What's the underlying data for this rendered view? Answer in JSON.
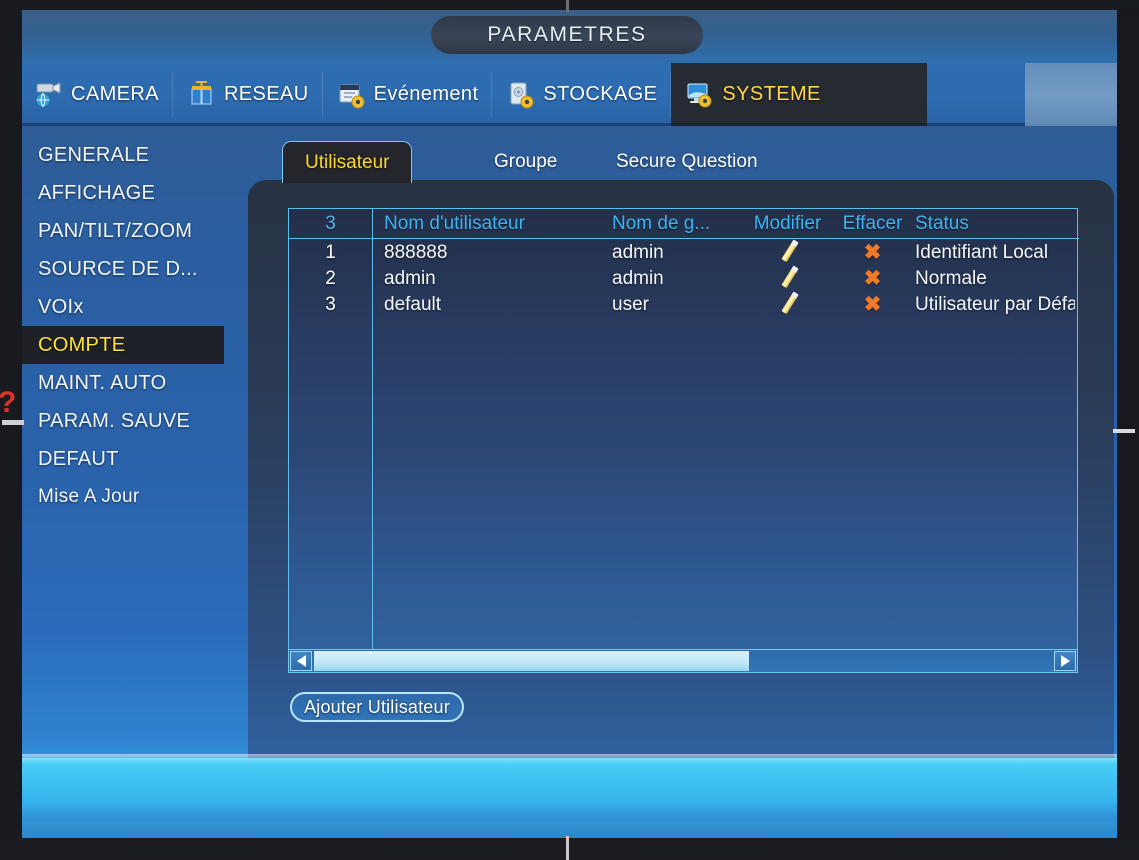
{
  "window": {
    "title": "PARAMETRES"
  },
  "nav": {
    "items": [
      {
        "label": "CAMERA",
        "icon": "camera-icon",
        "active": false
      },
      {
        "label": "RESEAU",
        "icon": "network-icon",
        "active": false
      },
      {
        "label": "Evénement",
        "icon": "event-icon",
        "active": false
      },
      {
        "label": "STOCKAGE",
        "icon": "storage-icon",
        "active": false
      },
      {
        "label": "SYSTEME",
        "icon": "system-icon",
        "active": true
      }
    ]
  },
  "sidebar": {
    "items": [
      {
        "label": "GENERALE",
        "selected": false
      },
      {
        "label": "AFFICHAGE",
        "selected": false
      },
      {
        "label": "PAN/TILT/ZOOM",
        "selected": false
      },
      {
        "label": "SOURCE DE D...",
        "selected": false
      },
      {
        "label": "VOIx",
        "selected": false
      },
      {
        "label": "COMPTE",
        "selected": true
      },
      {
        "label": "MAINT. AUTO",
        "selected": false
      },
      {
        "label": "PARAM. SAUVE",
        "selected": false
      },
      {
        "label": "DEFAUT",
        "selected": false
      },
      {
        "label": "Mise A Jour",
        "selected": false
      }
    ]
  },
  "tabs": [
    {
      "label": "Utilisateur",
      "active": true
    },
    {
      "label": "Groupe",
      "active": false
    },
    {
      "label": "Secure Question",
      "active": false
    }
  ],
  "table": {
    "headers": {
      "count": "3",
      "username": "Nom d'utilisateur",
      "groupname": "Nom de g...",
      "modify": "Modifier",
      "delete": "Effacer",
      "status": "Status"
    },
    "rows": [
      {
        "index": "1",
        "username": "888888",
        "groupname": "admin",
        "modify_icon": "pencil-icon",
        "delete_icon": "x-icon",
        "status": "Identifiant Local"
      },
      {
        "index": "2",
        "username": "admin",
        "groupname": "admin",
        "modify_icon": "pencil-icon",
        "delete_icon": "x-icon",
        "status": "Normale"
      },
      {
        "index": "3",
        "username": "default",
        "groupname": "user",
        "modify_icon": "pencil-icon",
        "delete_icon": "x-icon",
        "status": "Utilisateur par Défa"
      }
    ]
  },
  "scrollbar": {
    "left_arrow": "triangle-left-icon",
    "right_arrow": "triangle-right-icon"
  },
  "buttons": {
    "add_user": "Ajouter Utilisateur"
  },
  "overlay": {
    "question_mark": "?"
  },
  "colors": {
    "accent_yellow": "#ffd62e",
    "header_blue": "#3fb3f0",
    "border_cyan": "#5fbdf0",
    "delete_orange": "#ef7a2a",
    "pencil_yellow": "#f6e27a"
  }
}
